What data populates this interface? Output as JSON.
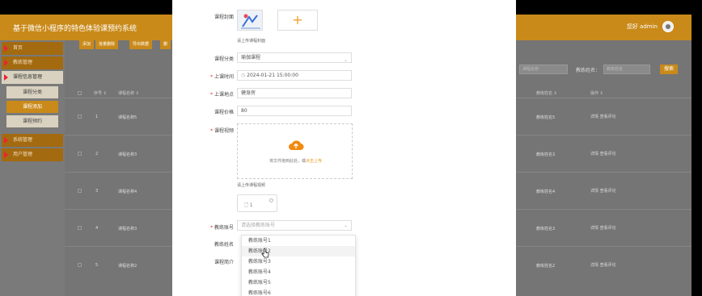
{
  "app": {
    "title": "基于微信小程序的特色体验课预约系统",
    "user_text": "您好 admin"
  },
  "sidebar": {
    "items": [
      {
        "label": "首页"
      },
      {
        "label": "教练管理"
      },
      {
        "label": "课程信息管理",
        "active": true
      }
    ],
    "sub_items": [
      {
        "label": "课程分类"
      },
      {
        "label": "课程添加",
        "active": true
      },
      {
        "label": "课程预约"
      }
    ],
    "items_after": [
      {
        "label": "系统管理"
      },
      {
        "label": "用户管理"
      }
    ]
  },
  "toolbar": {
    "buttons": [
      "添加",
      "批量删除",
      "导出数据",
      "删"
    ]
  },
  "search": {
    "field1_placeholder": "课程名称",
    "field2_label": "教练姓名：",
    "field2_placeholder": "教练姓名",
    "button": "搜索"
  },
  "table": {
    "headers": [
      "序号 ⇕",
      "课程名称 ⇕",
      "教练姓名 ⇕",
      "操作 ⇕"
    ],
    "rows": [
      {
        "no": "1",
        "name": "课程名称5",
        "coach": "教练姓名5",
        "actions": "详情 查看评论"
      },
      {
        "no": "2",
        "name": "课程名称3",
        "coach": "教练姓名3",
        "actions": "详情 查看评论"
      },
      {
        "no": "3",
        "name": "课程名称4",
        "coach": "教练姓名4",
        "actions": "详情 查看评论"
      },
      {
        "no": "4",
        "name": "课程名称3",
        "coach": "教练姓名3",
        "actions": "详情 查看评论"
      },
      {
        "no": "5",
        "name": "课程名称2",
        "coach": "教练姓名2",
        "actions": "详情 查看评论"
      }
    ]
  },
  "form": {
    "cover_label": "课程封面",
    "cover_hint": "请上传课程封面",
    "category_label": "课程分类",
    "category_value": "瑜伽课程",
    "time_label": "上课时间",
    "time_value": "2024-01-21 15:00:00",
    "place_label": "上课地点",
    "place_value": "健身房",
    "price_label": "课程价格",
    "price_value": "80",
    "video_label": "课程视频",
    "dropzone_text": "将文件拖到此处，或",
    "dropzone_link": "点击上传",
    "video_hint": "请上传课程视频",
    "file_name": "1",
    "coach_no_label": "教练账号",
    "coach_no_placeholder": "请选择教练账号",
    "coach_name_label": "教练姓名",
    "intro_label": "课程简介",
    "options": [
      "教练账号1",
      "教练账号2",
      "教练账号3",
      "教练账号4",
      "教练账号5",
      "教练账号6"
    ]
  },
  "icons": {
    "upload": "cloud-upload-icon",
    "plus": "plus-icon",
    "file": "document-icon",
    "chevron": "chevron-down-icon",
    "clock": "clock-icon"
  },
  "colors": {
    "brand": "#c98a1a",
    "accent": "#e6941a",
    "marker": "#e22233"
  }
}
